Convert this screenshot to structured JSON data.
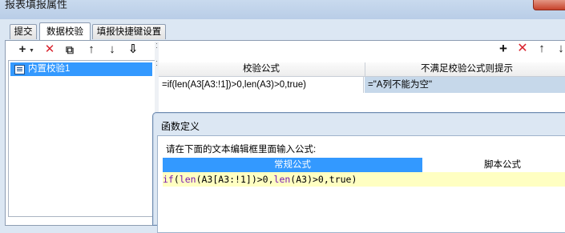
{
  "window": {
    "title": "报表填报属性"
  },
  "tabs": [
    {
      "label": "提交"
    },
    {
      "label": "数据校验"
    },
    {
      "label": "填报快捷键设置"
    }
  ],
  "left_toolbar": {
    "add": "+",
    "delete": "✕",
    "copy": "⧉",
    "up": "↑",
    "down": "↓",
    "sort": "⇩"
  },
  "list": {
    "items": [
      {
        "label": "内置校验1",
        "selected": true
      }
    ]
  },
  "grid": {
    "headers": [
      "校验公式",
      "不满足校验公式则提示"
    ],
    "rows": [
      {
        "formula": "=if(len(A3[A3:!1])>0,len(A3)>0,true)",
        "tip": "=\"A列不能为空\""
      }
    ]
  },
  "right_toolbar": {
    "add": "+",
    "delete": "✕",
    "up": "↑",
    "down": "↓"
  },
  "function_dialog": {
    "title": "函数定义",
    "prompt": "请在下面的文本编辑框里面输入公式:",
    "tabs": [
      "常规公式",
      "脚本公式"
    ],
    "formula_text": "if(len(A3[A3:!1])>0,len(A3)>0,true)"
  },
  "colors": {
    "selection": "#3399ff",
    "delete_icon": "#d9232e",
    "editor_background": "#ffffc2"
  }
}
